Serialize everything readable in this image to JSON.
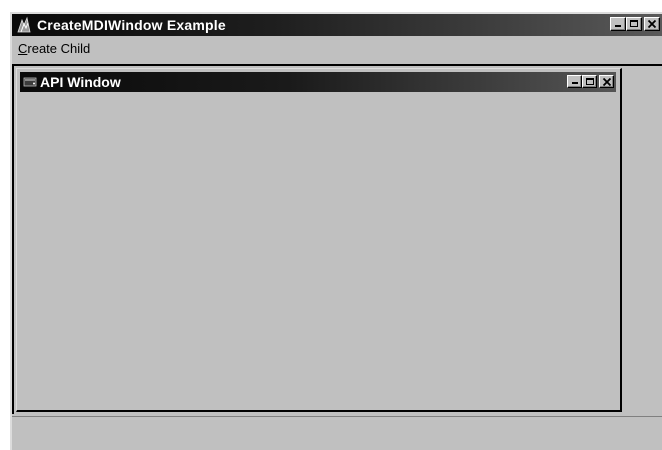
{
  "app_window": {
    "title": "CreateMDIWindow Example",
    "icon": "app-icon",
    "caption_buttons": [
      "minimize-icon",
      "maximize-icon",
      "close-icon"
    ]
  },
  "menubar": {
    "items": [
      {
        "accel": "C",
        "rest": "reate Child"
      }
    ]
  },
  "child_window": {
    "title": "API Window",
    "icon": "child-window-icon",
    "caption_buttons": [
      "minimize-icon",
      "maximize-icon",
      "close-icon"
    ]
  },
  "colors": {
    "face": "#c0c0c0",
    "titlebar_dark": "#0a0a0a",
    "titlebar_light": "#5a5a5a",
    "title_text": "#ffffff"
  }
}
